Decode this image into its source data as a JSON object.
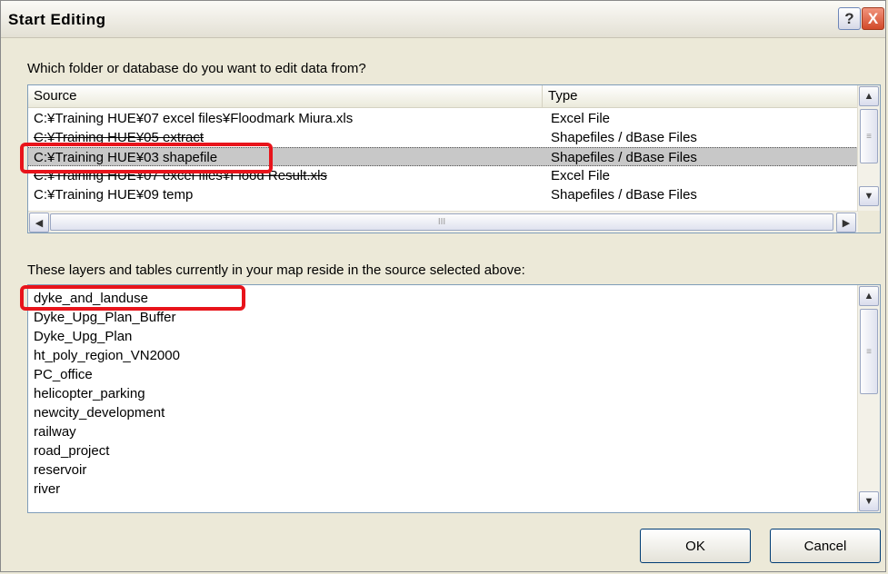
{
  "window": {
    "title": "Start Editing",
    "help_label": "?",
    "close_label": "X"
  },
  "source_prompt": "Which folder or database do you want to edit data from?",
  "source_table": {
    "columns": [
      "Source",
      "Type"
    ],
    "rows": [
      {
        "source": "C:¥Training HUE¥07 excel files¥Floodmark Miura.xls",
        "type": "Excel File"
      },
      {
        "source": "C:¥Training HUE¥05 extract",
        "type": "Shapefiles / dBase Files"
      },
      {
        "source": "C:¥Training HUE¥03 shapefile",
        "type": "Shapefiles / dBase Files"
      },
      {
        "source": "C:¥Training HUE¥07 excel files¥Flood Result.xls",
        "type": "Excel File"
      },
      {
        "source": "C:¥Training HUE¥09 temp",
        "type": "Shapefiles / dBase Files"
      }
    ],
    "selected_row": "C:¥Training HUE¥03 shapefile"
  },
  "layers_prompt": "These layers and tables currently in your map reside in the source selected above:",
  "layers": [
    "dyke_and_landuse",
    "Dyke_Upg_Plan_Buffer",
    "Dyke_Upg_Plan",
    "ht_poly_region_VN2000",
    "PC_office",
    "helicopter_parking",
    "newcity_development",
    "railway",
    "road_project",
    "reservoir",
    "river"
  ],
  "buttons": {
    "ok": "OK",
    "cancel": "Cancel"
  },
  "scroll": {
    "up": "▲",
    "down": "▼",
    "left": "◀",
    "right": "▶",
    "grip_v": "≡",
    "grip_h": "III"
  },
  "colors": {
    "highlight": "#e8141b",
    "selection": "#c8c8c8"
  }
}
